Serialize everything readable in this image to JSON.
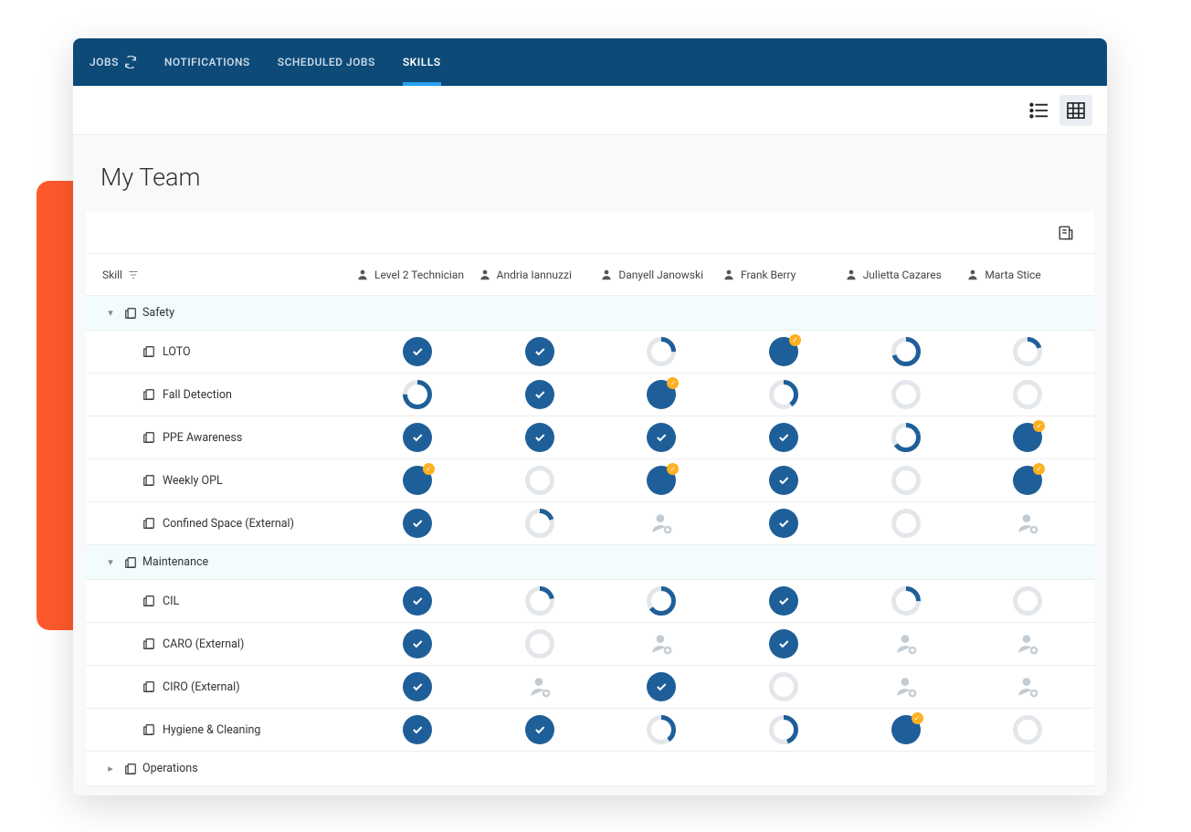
{
  "nav": {
    "tabs": [
      {
        "label": "JOBS",
        "icon": "refresh",
        "active": false
      },
      {
        "label": "NOTIFICATIONS",
        "active": false
      },
      {
        "label": "SCHEDULED JOBS",
        "active": false
      },
      {
        "label": "SKILLS",
        "active": true
      }
    ]
  },
  "page": {
    "title": "My Team"
  },
  "columns": {
    "skill_header": "Skill",
    "people": [
      "Level 2 Technician",
      "Andria Iannuzzi",
      "Danyell Janowski",
      "Frank Berry",
      "Julietta Cazares",
      "Marta Stice"
    ]
  },
  "groups": [
    {
      "name": "Safety",
      "expanded": true,
      "rows": [
        {
          "skill": "LOTO",
          "cells": [
            "check",
            "check",
            "p:25",
            "full-b",
            "p:70",
            "p:20"
          ]
        },
        {
          "skill": "Fall Detection",
          "cells": [
            "p:75",
            "check",
            "full-b",
            "p:40",
            "p:0",
            "p:0"
          ]
        },
        {
          "skill": "PPE Awareness",
          "cells": [
            "check",
            "check",
            "check",
            "check",
            "p:65",
            "full-b"
          ]
        },
        {
          "skill": "Weekly OPL",
          "cells": [
            "full-b",
            "p:0",
            "full-b",
            "check",
            "p:0",
            "full-b"
          ]
        },
        {
          "skill": "Confined Space (External)",
          "cells": [
            "check",
            "p:20",
            "assign",
            "check",
            "p:0",
            "assign"
          ]
        }
      ]
    },
    {
      "name": "Maintenance",
      "expanded": true,
      "rows": [
        {
          "skill": "CIL",
          "cells": [
            "check",
            "p:22",
            "p:65",
            "check",
            "p:25",
            "p:0"
          ]
        },
        {
          "skill": "CARO (External)",
          "cells": [
            "check",
            "p:0",
            "assign",
            "check",
            "assign",
            "assign"
          ]
        },
        {
          "skill": "CIRO (External)",
          "cells": [
            "check",
            "assign",
            "check",
            "p:0",
            "assign",
            "assign"
          ]
        },
        {
          "skill": "Hygiene & Cleaning",
          "cells": [
            "check",
            "check",
            "p:40",
            "p:45",
            "full-b",
            "p:0"
          ]
        }
      ]
    },
    {
      "name": "Operations",
      "expanded": false,
      "rows": []
    }
  ],
  "view_toggle": {
    "list": "list",
    "grid": "grid",
    "active": "grid"
  },
  "colors": {
    "accent": "#1f5f99",
    "navbg": "#0d4a78",
    "badge": "#ffb020",
    "backdrop": "#ff5a2c"
  }
}
